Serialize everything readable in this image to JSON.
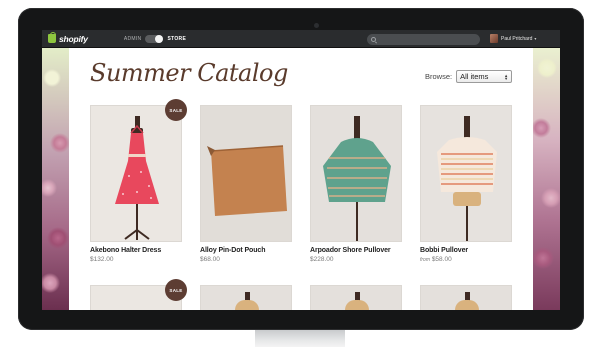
{
  "admin_bar": {
    "logo_text": "shopify",
    "mode_admin": "ADMIN",
    "mode_store": "STORE",
    "search_placeholder": "",
    "user_name": "Paul Pritchard",
    "user_caret": "▾"
  },
  "catalog": {
    "title": "Summer Catalog",
    "browse_label": "Browse:",
    "browse_value": "All items"
  },
  "products": [
    {
      "name": "Akebono Halter Dress",
      "price_prefix": "",
      "price": "$132.00",
      "badge": "SALE"
    },
    {
      "name": "Alloy Pin-Dot Pouch",
      "price_prefix": "",
      "price": "$68.00",
      "badge": ""
    },
    {
      "name": "Arpoador Shore Pullover",
      "price_prefix": "",
      "price": "$228.00",
      "badge": ""
    },
    {
      "name": "Bobbi Pullover",
      "price_prefix": "from",
      "price": "$58.00",
      "badge": ""
    }
  ],
  "second_row_badge": "SALE",
  "colors": {
    "admin_bar": "#2a2c2e",
    "sale_badge": "#5d3d33",
    "title": "#5a3b2c",
    "shopify_green": "#8ec63f"
  },
  "icons": [
    "shopify-bag-icon",
    "search-icon",
    "chevron-down-icon",
    "select-arrows-icon"
  ]
}
